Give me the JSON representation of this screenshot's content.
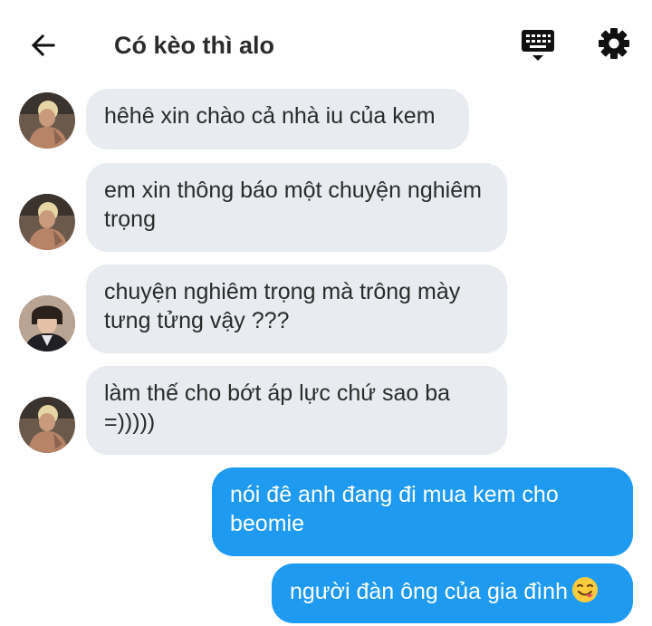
{
  "header": {
    "title": "Có kèo thì alo"
  },
  "messages": [
    {
      "direction": "incoming",
      "sender_avatar": "avatar-blond",
      "text": "hêhê xin chào cả nhà iu của kem"
    },
    {
      "direction": "incoming",
      "sender_avatar": "avatar-blond",
      "text": "em xin thông báo một chuyện nghiêm trọng"
    },
    {
      "direction": "incoming",
      "sender_avatar": "avatar-dark-hair",
      "text": "chuyện nghiêm trọng mà trông mày tưng tửng vậy ???"
    },
    {
      "direction": "incoming",
      "sender_avatar": "avatar-blond",
      "text": "làm thế cho bớt áp lực chứ sao ba =)))))"
    },
    {
      "direction": "outgoing",
      "text": "nói đê anh đang đi mua kem cho beomie"
    },
    {
      "direction": "outgoing",
      "text": "người đàn ông của gia đình",
      "emoji": "yum-face-emoji"
    }
  ],
  "colors": {
    "incoming_bubble": "#e8ebef",
    "outgoing_bubble": "#1e9af0",
    "icon": "#111111"
  },
  "icons": [
    "back-arrow-icon",
    "keyboard-icon",
    "gear-icon"
  ]
}
